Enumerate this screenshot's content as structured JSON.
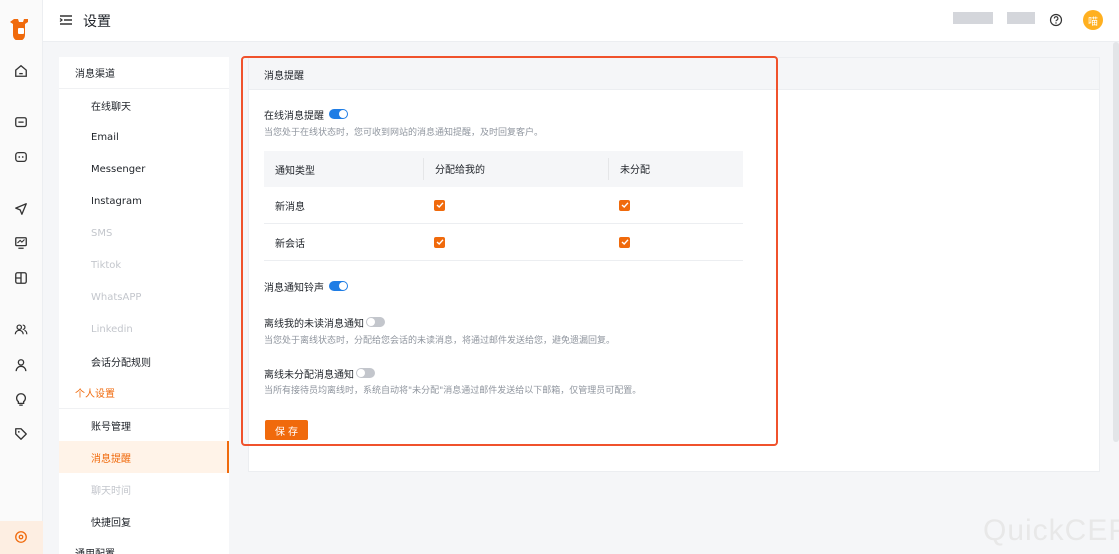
{
  "header": {
    "title": "设置",
    "avatar_text": "喵"
  },
  "subnav": {
    "items": [
      {
        "label": "消息渠道",
        "kind": "group"
      },
      {
        "label": "在线聊天",
        "kind": "child"
      },
      {
        "label": "Email",
        "kind": "child"
      },
      {
        "label": "Messenger",
        "kind": "child"
      },
      {
        "label": "Instagram",
        "kind": "child"
      },
      {
        "label": "SMS",
        "kind": "child-disabled"
      },
      {
        "label": "Tiktok",
        "kind": "child-disabled"
      },
      {
        "label": "WhatsAPP",
        "kind": "child-disabled"
      },
      {
        "label": "Linkedin",
        "kind": "child-disabled"
      },
      {
        "label": "会话分配规则",
        "kind": "child"
      },
      {
        "label": "个人设置",
        "kind": "group-active"
      },
      {
        "label": "账号管理",
        "kind": "child"
      },
      {
        "label": "消息提醒",
        "kind": "child-selected"
      },
      {
        "label": "聊天时间",
        "kind": "child-disabled"
      },
      {
        "label": "快捷回复",
        "kind": "child"
      },
      {
        "label": "通用配置",
        "kind": "group"
      }
    ]
  },
  "panel": {
    "title": "消息提醒",
    "online_reminder": {
      "label": "在线消息提醒",
      "enabled": true,
      "desc": "当您处于在线状态时，您可收到网站的消息通知提醒，及时回复客户。"
    },
    "table": {
      "headers": [
        "通知类型",
        "分配给我的",
        "未分配"
      ],
      "rows": [
        {
          "type": "新消息",
          "assigned_to_me": true,
          "unassigned": true
        },
        {
          "type": "新会话",
          "assigned_to_me": true,
          "unassigned": true
        }
      ]
    },
    "ringtone": {
      "label": "消息通知铃声",
      "enabled": true
    },
    "offline_mine": {
      "label": "离线我的未读消息通知",
      "enabled": false,
      "desc": "当您处于离线状态时，分配给您会话的未读消息，将通过邮件发送给您，避免遗漏回复。"
    },
    "offline_unassigned": {
      "label": "离线未分配消息通知",
      "enabled": false,
      "desc": "当所有接待员均离线时，系统自动将\"未分配\"消息通过邮件发送给以下邮箱，仅管理员可配置。"
    },
    "save_label": "保存"
  },
  "watermark": "QuickCEP",
  "colors": {
    "accent": "#f06a0c",
    "toggle_on": "#1f7de5",
    "highlight": "#f0522c"
  }
}
